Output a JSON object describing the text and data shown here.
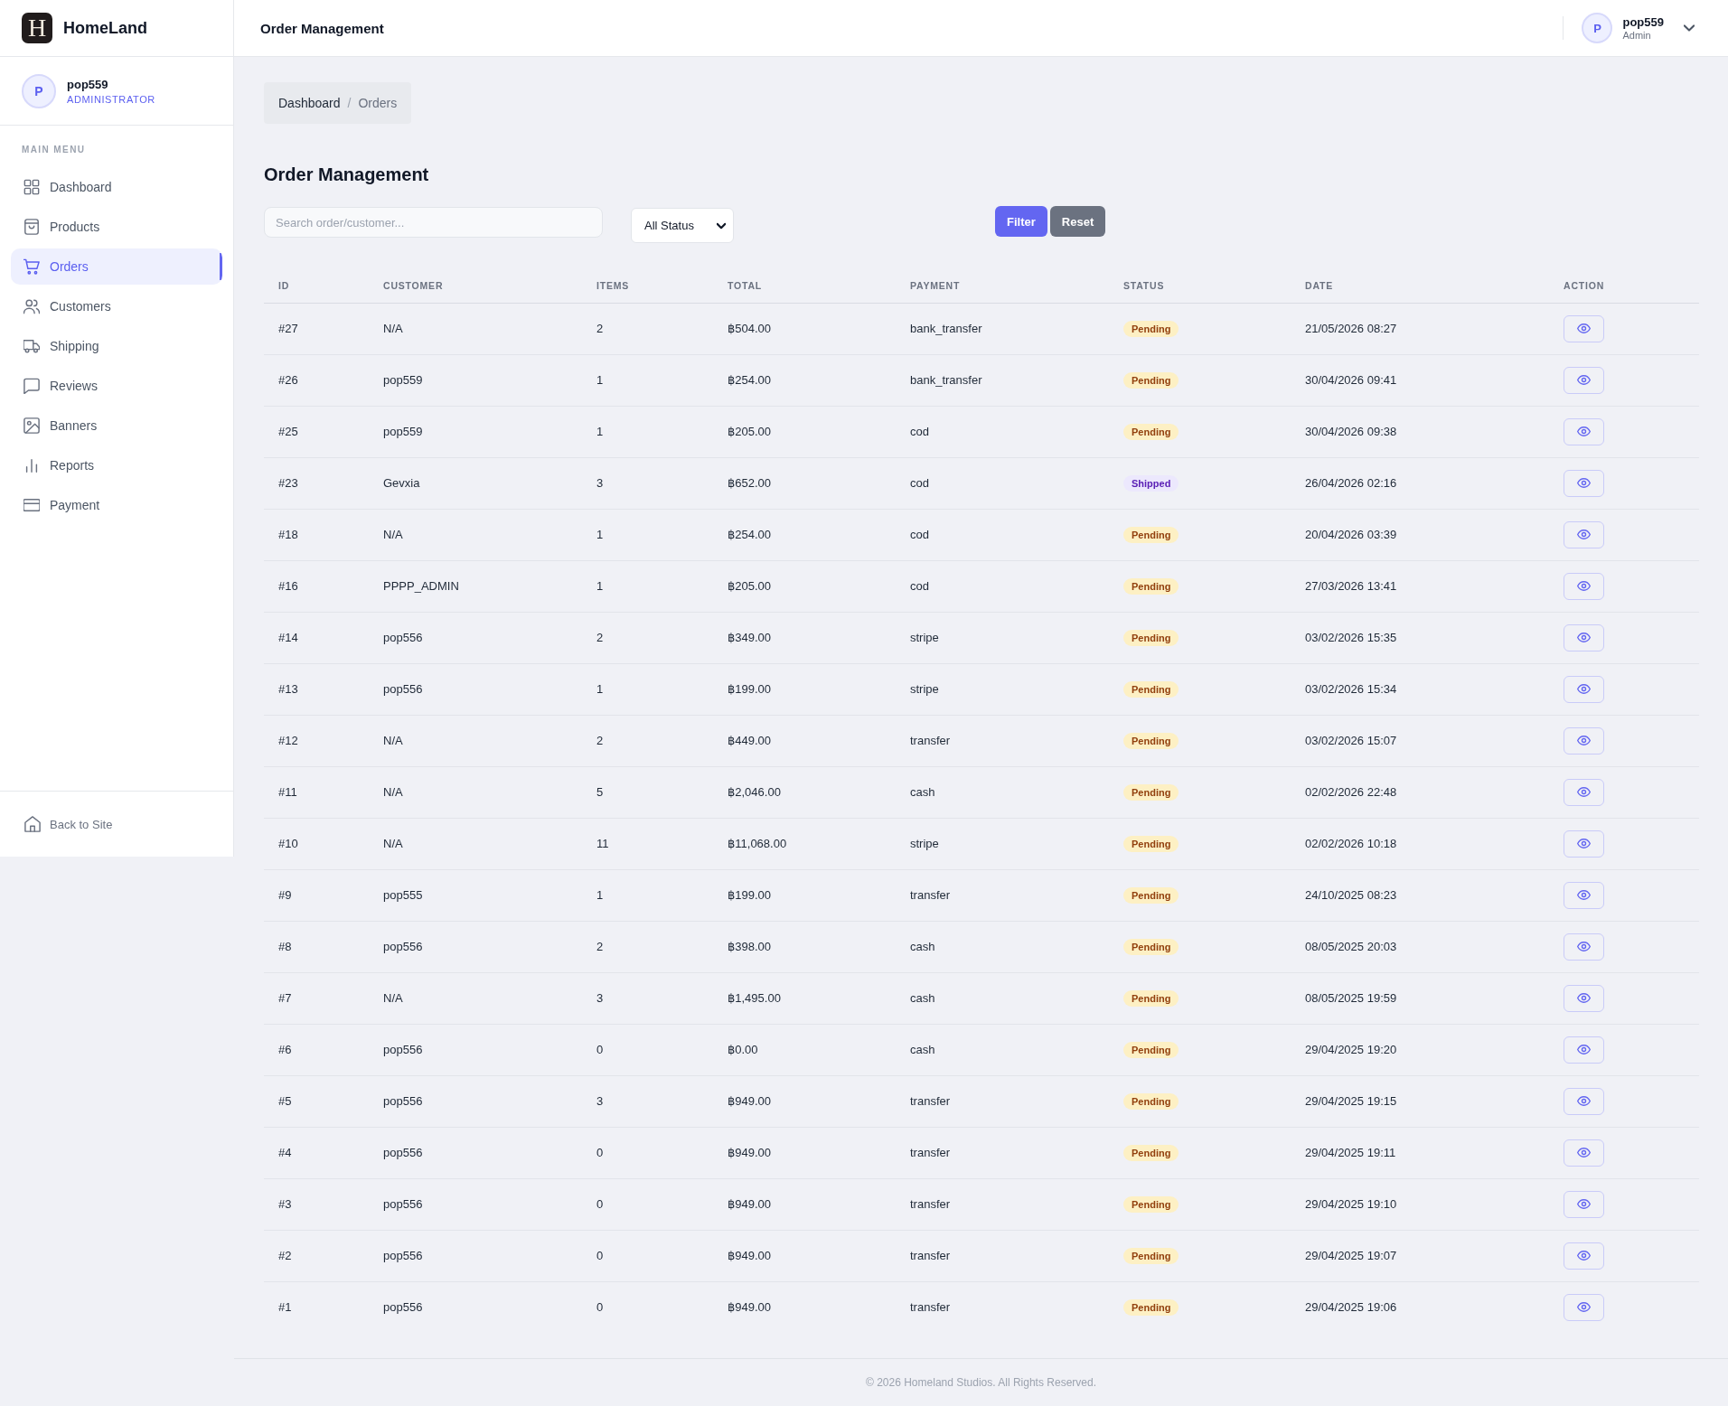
{
  "sidebar": {
    "brand": {
      "logo_text": "H",
      "name": "HomeLand"
    },
    "user": {
      "initial": "P",
      "name": "pop559",
      "role": "ADMINISTRATOR"
    },
    "section_label": "MAIN MENU",
    "items": [
      {
        "label": "Dashboard",
        "selected": false
      },
      {
        "label": "Products",
        "selected": false
      },
      {
        "label": "Orders",
        "selected": true
      },
      {
        "label": "Customers",
        "selected": false
      },
      {
        "label": "Shipping",
        "selected": false
      },
      {
        "label": "Reviews",
        "selected": false
      },
      {
        "label": "Banners",
        "selected": false
      },
      {
        "label": "Reports",
        "selected": false
      },
      {
        "label": "Payment",
        "selected": false
      }
    ],
    "footer_link": {
      "label": "Back to Site"
    }
  },
  "header": {
    "title": "Order Management",
    "user": {
      "initial": "P",
      "name": "pop559",
      "role": "Admin"
    }
  },
  "breadcrumb": {
    "separator": "/",
    "items": [
      {
        "label": "Dashboard",
        "current": false
      },
      {
        "label": "Orders",
        "current": true
      }
    ]
  },
  "page_title": "Order Management",
  "filters": {
    "search": {
      "placeholder": "Search order/customer..."
    },
    "status_select": {
      "value": "All Status"
    },
    "buttons": [
      {
        "label": "Filter",
        "kind": "primary"
      },
      {
        "label": "Reset",
        "kind": "secondary"
      }
    ]
  },
  "table": {
    "columns": [
      "ID",
      "CUSTOMER",
      "ITEMS",
      "TOTAL",
      "PAYMENT",
      "STATUS",
      "DATE",
      "ACTION"
    ],
    "rows": [
      {
        "id": "#27",
        "customer": "N/A",
        "items": "2",
        "total": "฿504.00",
        "payment": "bank_transfer",
        "status": {
          "label": "Pending",
          "kind": "pending"
        },
        "date": "21/05/2026 08:27"
      },
      {
        "id": "#26",
        "customer": "pop559",
        "items": "1",
        "total": "฿254.00",
        "payment": "bank_transfer",
        "status": {
          "label": "Pending",
          "kind": "pending"
        },
        "date": "30/04/2026 09:41"
      },
      {
        "id": "#25",
        "customer": "pop559",
        "items": "1",
        "total": "฿205.00",
        "payment": "cod",
        "status": {
          "label": "Pending",
          "kind": "pending"
        },
        "date": "30/04/2026 09:38"
      },
      {
        "id": "#23",
        "customer": "Gevxia",
        "items": "3",
        "total": "฿652.00",
        "payment": "cod",
        "status": {
          "label": "Shipped",
          "kind": "shipped"
        },
        "date": "26/04/2026 02:16"
      },
      {
        "id": "#18",
        "customer": "N/A",
        "items": "1",
        "total": "฿254.00",
        "payment": "cod",
        "status": {
          "label": "Pending",
          "kind": "pending"
        },
        "date": "20/04/2026 03:39"
      },
      {
        "id": "#16",
        "customer": "PPPP_ADMIN",
        "items": "1",
        "total": "฿205.00",
        "payment": "cod",
        "status": {
          "label": "Pending",
          "kind": "pending"
        },
        "date": "27/03/2026 13:41"
      },
      {
        "id": "#14",
        "customer": "pop556",
        "items": "2",
        "total": "฿349.00",
        "payment": "stripe",
        "status": {
          "label": "Pending",
          "kind": "pending"
        },
        "date": "03/02/2026 15:35"
      },
      {
        "id": "#13",
        "customer": "pop556",
        "items": "1",
        "total": "฿199.00",
        "payment": "stripe",
        "status": {
          "label": "Pending",
          "kind": "pending"
        },
        "date": "03/02/2026 15:34"
      },
      {
        "id": "#12",
        "customer": "N/A",
        "items": "2",
        "total": "฿449.00",
        "payment": "transfer",
        "status": {
          "label": "Pending",
          "kind": "pending"
        },
        "date": "03/02/2026 15:07"
      },
      {
        "id": "#11",
        "customer": "N/A",
        "items": "5",
        "total": "฿2,046.00",
        "payment": "cash",
        "status": {
          "label": "Pending",
          "kind": "pending"
        },
        "date": "02/02/2026 22:48"
      },
      {
        "id": "#10",
        "customer": "N/A",
        "items": "11",
        "total": "฿11,068.00",
        "payment": "stripe",
        "status": {
          "label": "Pending",
          "kind": "pending"
        },
        "date": "02/02/2026 10:18"
      },
      {
        "id": "#9",
        "customer": "pop555",
        "items": "1",
        "total": "฿199.00",
        "payment": "transfer",
        "status": {
          "label": "Pending",
          "kind": "pending"
        },
        "date": "24/10/2025 08:23"
      },
      {
        "id": "#8",
        "customer": "pop556",
        "items": "2",
        "total": "฿398.00",
        "payment": "cash",
        "status": {
          "label": "Pending",
          "kind": "pending"
        },
        "date": "08/05/2025 20:03"
      },
      {
        "id": "#7",
        "customer": "N/A",
        "items": "3",
        "total": "฿1,495.00",
        "payment": "cash",
        "status": {
          "label": "Pending",
          "kind": "pending"
        },
        "date": "08/05/2025 19:59"
      },
      {
        "id": "#6",
        "customer": "pop556",
        "items": "0",
        "total": "฿0.00",
        "payment": "cash",
        "status": {
          "label": "Pending",
          "kind": "pending"
        },
        "date": "29/04/2025 19:20"
      },
      {
        "id": "#5",
        "customer": "pop556",
        "items": "3",
        "total": "฿949.00",
        "payment": "transfer",
        "status": {
          "label": "Pending",
          "kind": "pending"
        },
        "date": "29/04/2025 19:15"
      },
      {
        "id": "#4",
        "customer": "pop556",
        "items": "0",
        "total": "฿949.00",
        "payment": "transfer",
        "status": {
          "label": "Pending",
          "kind": "pending"
        },
        "date": "29/04/2025 19:11"
      },
      {
        "id": "#3",
        "customer": "pop556",
        "items": "0",
        "total": "฿949.00",
        "payment": "transfer",
        "status": {
          "label": "Pending",
          "kind": "pending"
        },
        "date": "29/04/2025 19:10"
      },
      {
        "id": "#2",
        "customer": "pop556",
        "items": "0",
        "total": "฿949.00",
        "payment": "transfer",
        "status": {
          "label": "Pending",
          "kind": "pending"
        },
        "date": "29/04/2025 19:07"
      },
      {
        "id": "#1",
        "customer": "pop556",
        "items": "0",
        "total": "฿949.00",
        "payment": "transfer",
        "status": {
          "label": "Pending",
          "kind": "pending"
        },
        "date": "29/04/2025 19:06"
      }
    ]
  },
  "footer": {
    "text": "© 2026 Homeland Studios. All Rights Reserved."
  }
}
